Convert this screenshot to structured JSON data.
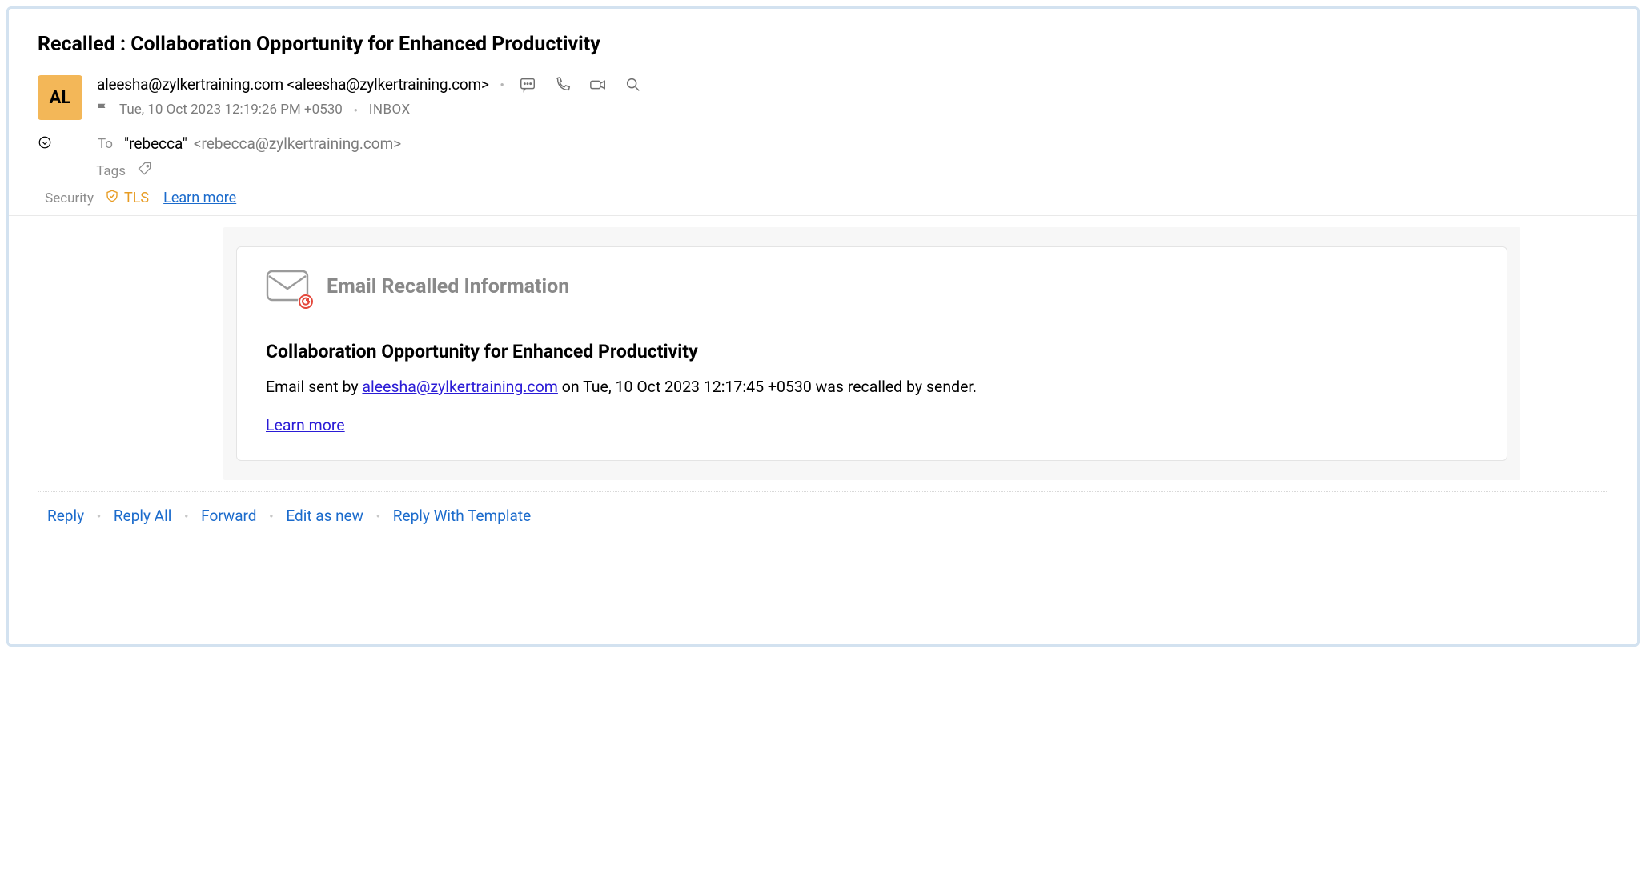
{
  "subject": "Recalled : Collaboration Opportunity for Enhanced Productivity",
  "avatar_initials": "AL",
  "from": {
    "display": "aleesha@zylkertraining.com",
    "address": "<aleesha@zylkertraining.com>"
  },
  "meta": {
    "date": "Tue, 10 Oct 2023 12:19:26 PM +0530",
    "folder": "INBOX"
  },
  "to": {
    "label": "To",
    "name": "\"rebecca\"",
    "address": "<rebecca@zylkertraining.com>"
  },
  "tags_label": "Tags",
  "security": {
    "label": "Security",
    "tls": "TLS",
    "learn_more": "Learn more"
  },
  "recall_card": {
    "header": "Email Recalled Information",
    "subject": "Collaboration Opportunity for Enhanced Productivity",
    "prefix": "Email sent by ",
    "sender": "aleesha@zylkertraining.com",
    "middle": " on Tue, 10 Oct 2023 12:17:45 +0530 was recalled by sender.",
    "learn_more": "Learn more"
  },
  "actions": {
    "reply": "Reply",
    "reply_all": "Reply All",
    "forward": "Forward",
    "edit_as_new": "Edit as new",
    "reply_template": "Reply With Template"
  }
}
